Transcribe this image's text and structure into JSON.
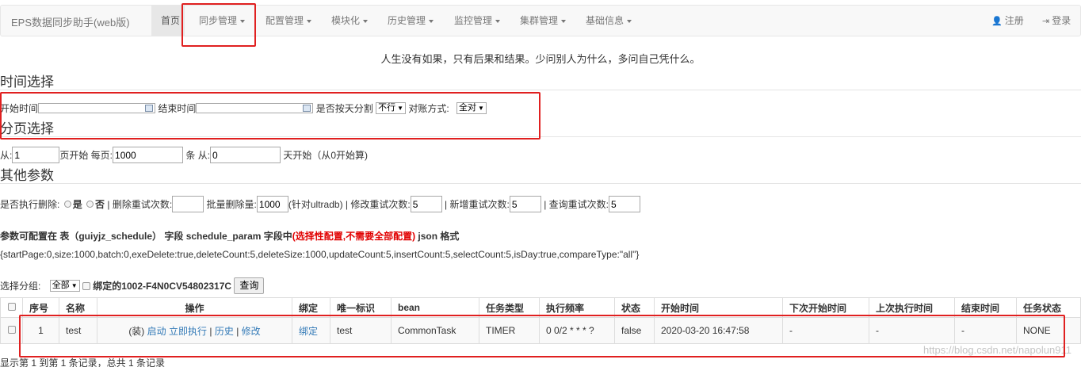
{
  "nav": {
    "brand": "EPS数据同步助手(web版)",
    "items": [
      "首页",
      "同步管理",
      "配置管理",
      "模块化",
      "历史管理",
      "监控管理",
      "集群管理",
      "基础信息"
    ],
    "register": "注册",
    "login": "登录"
  },
  "motto": "人生没有如果，只有后果和结果。少问别人为什么，多问自己凭什么。",
  "time_section": {
    "title": "时间选择",
    "start_label": "开始时间",
    "end_label": "结束时间",
    "split_label": "是否按天分割",
    "split_value": "不行",
    "compare_label": "对账方式:",
    "compare_value": "全对"
  },
  "page_section": {
    "title": "分页选择",
    "from_label": "从:",
    "from_value": "1",
    "page_start_label": "页开始 每页:",
    "per_page_value": "1000",
    "from2_label": "条 从:",
    "from2_value": "0",
    "day_start_label": "天开始（从0开始算)"
  },
  "other_section": {
    "title": "其他参数",
    "exec_delete_label": "是否执行删除:",
    "yes": "是",
    "no": "否",
    "delete_retry_label": "| 删除重试次数:",
    "delete_retry_value": "",
    "batch_delete_label": "批量删除量:",
    "batch_delete_value": "1000",
    "ultradb_label": "(针对ultradb) | 修改重试次数:",
    "update_retry_value": "5",
    "insert_retry_label": "| 新增重试次数:",
    "insert_retry_value": "5",
    "select_retry_label": "| 查询重试次数:",
    "select_retry_value": "5"
  },
  "config_note": {
    "prefix": "参数可配置在 表（guiyjz_schedule） 字段 schedule_param 字段中",
    "red": "(选择性配置,不需要全部配置)",
    "suffix": " json 格式",
    "json": "{startPage:0,size:1000,batch:0,exeDelete:true,deleteCount:5,deleteSize:1000,updateCount:5,insertCount:5,selectCount:5,isDay:true,compareType:\"all\"}"
  },
  "group": {
    "label": "选择分组:",
    "value": "全部",
    "bound_label": "绑定的1002-F4N0CV54802317C",
    "query_btn": "查询"
  },
  "table": {
    "headers": [
      "序号",
      "名称",
      "操作",
      "绑定",
      "唯一标识",
      "bean",
      "任务类型",
      "执行频率",
      "状态",
      "开始时间",
      "下次开始时间",
      "上次执行时间",
      "结束时间",
      "任务状态"
    ],
    "rows": [
      {
        "index": "1",
        "name": "test",
        "op_prefix": "(装)",
        "op_start": "启动",
        "op_run": "立即执行",
        "sep1": "|",
        "op_history": "历史",
        "sep2": "|",
        "op_edit": "修改",
        "bind": "绑定",
        "uid": "test",
        "bean": "CommonTask",
        "type": "TIMER",
        "cron": "0 0/2 * * * ?",
        "status": "false",
        "start": "2020-03-20 16:47:58",
        "next": "-",
        "last": "-",
        "end": "-",
        "task_status": "NONE"
      }
    ]
  },
  "footer": "显示第 1 到第 1 条记录，总共 1 条记录",
  "watermark": "https://blog.csdn.net/napolun911"
}
